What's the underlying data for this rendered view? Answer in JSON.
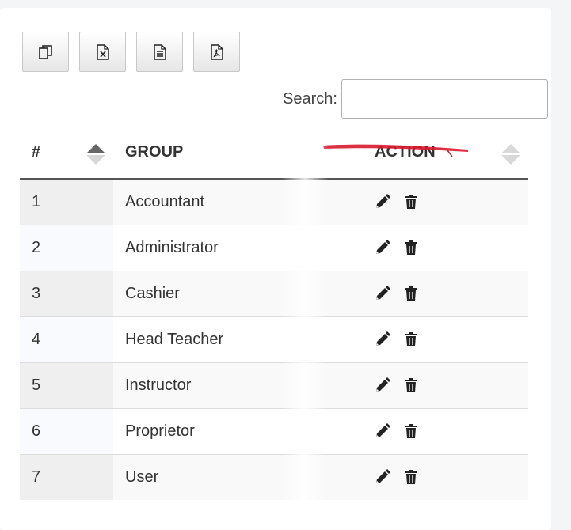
{
  "toolbar": {
    "buttons": [
      {
        "name": "copy",
        "icon": "copy-icon"
      },
      {
        "name": "excel",
        "icon": "excel-file-icon"
      },
      {
        "name": "csv",
        "icon": "text-file-icon"
      },
      {
        "name": "pdf",
        "icon": "pdf-file-icon"
      }
    ]
  },
  "search": {
    "label": "Search:",
    "value": "",
    "placeholder": ""
  },
  "table": {
    "headers": {
      "num": "#",
      "group": "GROUP",
      "action": "ACTION"
    },
    "rows": [
      {
        "num": "1",
        "group": "Accountant"
      },
      {
        "num": "2",
        "group": "Administrator"
      },
      {
        "num": "3",
        "group": "Cashier"
      },
      {
        "num": "4",
        "group": "Head Teacher"
      },
      {
        "num": "5",
        "group": "Instructor"
      },
      {
        "num": "6",
        "group": "Proprietor"
      },
      {
        "num": "7",
        "group": "User"
      }
    ],
    "row_actions": [
      "edit-pencil-icon",
      "delete-trash-icon"
    ]
  },
  "colors": {
    "header_border": "#555555",
    "scribble": "#d8182c"
  }
}
